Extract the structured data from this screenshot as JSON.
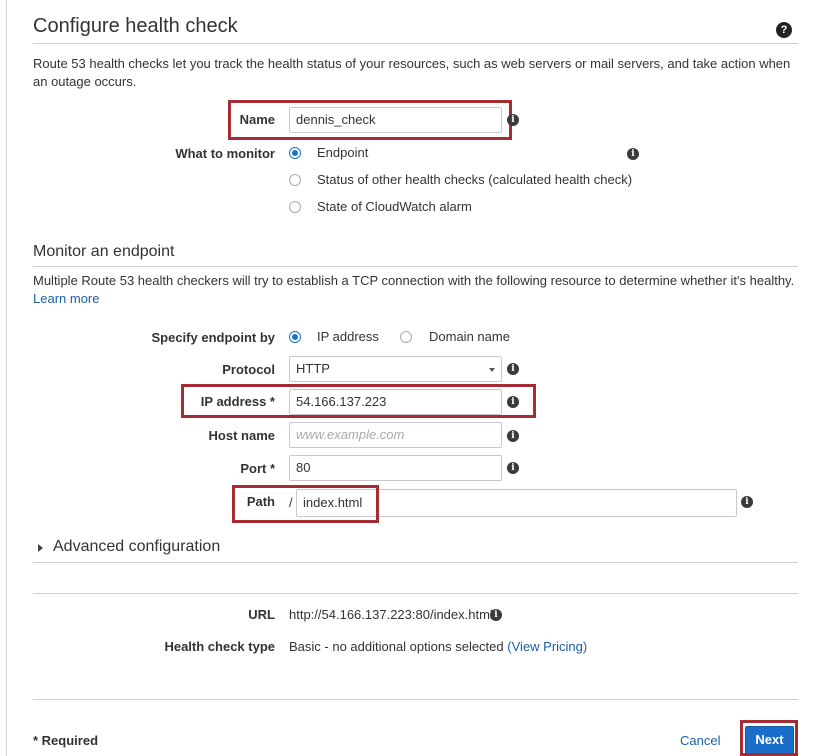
{
  "header": {
    "title": "Configure health check",
    "description": "Route 53 health checks let you track the health status of your resources, such as web servers or mail servers, and take action when an outage occurs."
  },
  "form": {
    "name_label": "Name",
    "name_value": "dennis_check",
    "monitor_label": "What to monitor",
    "monitor_options": [
      "Endpoint",
      "Status of other health checks (calculated health check)",
      "State of CloudWatch alarm"
    ],
    "monitor_selected": "Endpoint"
  },
  "endpoint": {
    "title": "Monitor an endpoint",
    "description": "Multiple Route 53 health checkers will try to establish a TCP connection with the following resource to determine whether it's healthy.",
    "learn_more": "Learn more",
    "specify_label": "Specify endpoint by",
    "specify_options": [
      "IP address",
      "Domain name"
    ],
    "specify_selected": "IP address",
    "protocol_label": "Protocol",
    "protocol_value": "HTTP",
    "ip_label": "IP address *",
    "ip_value": "54.166.137.223",
    "host_label": "Host name",
    "host_placeholder": "www.example.com",
    "port_label": "Port *",
    "port_value": "80",
    "path_label": "Path",
    "path_prefix": "/",
    "path_value": "index.html"
  },
  "advanced": {
    "label": "Advanced configuration"
  },
  "summary": {
    "url_label": "URL",
    "url_value": "http://54.166.137.223:80/index.html",
    "type_label": "Health check type",
    "type_value": "Basic - no additional options selected",
    "pricing_link": "(View Pricing)"
  },
  "footer": {
    "required_note": "* Required",
    "cancel_label": "Cancel",
    "next_label": "Next"
  },
  "colors": {
    "highlight": "#a52b34",
    "accent": "#1a6dc9",
    "link": "#1d5fa6"
  }
}
